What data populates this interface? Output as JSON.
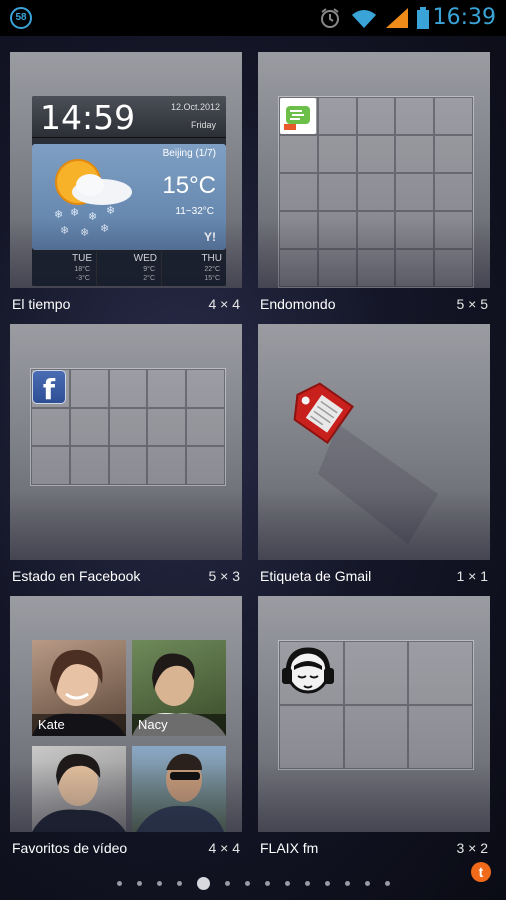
{
  "status_bar": {
    "notification_count": "58",
    "time": "16:39",
    "icons": [
      "alarm-icon",
      "wifi-icon",
      "signal-icon",
      "battery-icon"
    ],
    "accent_color": "#3aa4d8"
  },
  "widgets": [
    {
      "name": "El tiempo",
      "size": "4 × 4",
      "weather": {
        "clock": "14:59",
        "date": "12.Oct.2012",
        "day": "Friday",
        "city": "Beijing (1/7)",
        "temp": "15°C",
        "range": "11~32°C",
        "brand": "Y!",
        "forecast": [
          {
            "day": "TUE",
            "hi": "18°C",
            "lo": "-3°C"
          },
          {
            "day": "WED",
            "hi": "9°C",
            "lo": "2°C"
          },
          {
            "day": "THU",
            "hi": "22°C",
            "lo": "15°C"
          }
        ]
      }
    },
    {
      "name": "Endomondo",
      "size": "5 × 5",
      "icon": "endomondo-icon"
    },
    {
      "name": "Estado en Facebook",
      "size": "5 × 3",
      "icon_letter": "f"
    },
    {
      "name": "Etiqueta de Gmail",
      "size": "1 × 1",
      "icon": "gmail-label-icon"
    },
    {
      "name": "Favoritos de vídeo",
      "size": "4 × 4",
      "contacts": [
        "Kate",
        "Nacy"
      ]
    },
    {
      "name": "FLAIX fm",
      "size": "3 × 2",
      "icon": "flaix-fm-icon"
    }
  ],
  "pager": {
    "dot_count": 14,
    "active_index": 4
  },
  "corner_badge": "t"
}
